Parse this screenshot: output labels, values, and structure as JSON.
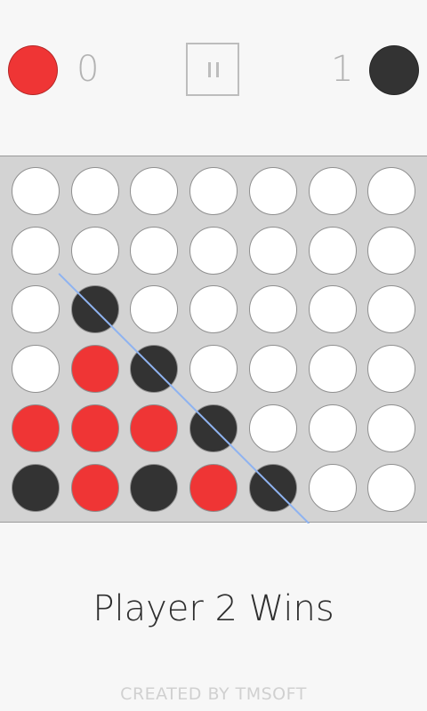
{
  "colors": {
    "red": "#ef3535",
    "black": "#333333",
    "empty": "#ffffff",
    "board": "#d3d3d3",
    "win_line": "#8fb3f0"
  },
  "scoreboard": {
    "player1": {
      "disc_color": "red",
      "score": "0"
    },
    "player2": {
      "disc_color": "black",
      "score": "1"
    },
    "pause_icon": "pause-icon"
  },
  "board": {
    "rows": 6,
    "cols": 7,
    "grid": [
      [
        "",
        "",
        "",
        "",
        "",
        "",
        ""
      ],
      [
        "",
        "",
        "",
        "",
        "",
        "",
        ""
      ],
      [
        "",
        "B",
        "",
        "",
        "",
        "",
        ""
      ],
      [
        "",
        "R",
        "B",
        "",
        "",
        "",
        ""
      ],
      [
        "R",
        "R",
        "R",
        "B",
        "",
        "",
        ""
      ],
      [
        "B",
        "R",
        "B",
        "R",
        "B",
        "",
        ""
      ]
    ],
    "winning_line": {
      "from_cell": [
        2,
        1
      ],
      "to_cell": [
        5,
        4
      ]
    }
  },
  "status": {
    "text": "Player 2 Wins"
  },
  "footer": {
    "credit": "CREATED BY TMSOFT"
  }
}
